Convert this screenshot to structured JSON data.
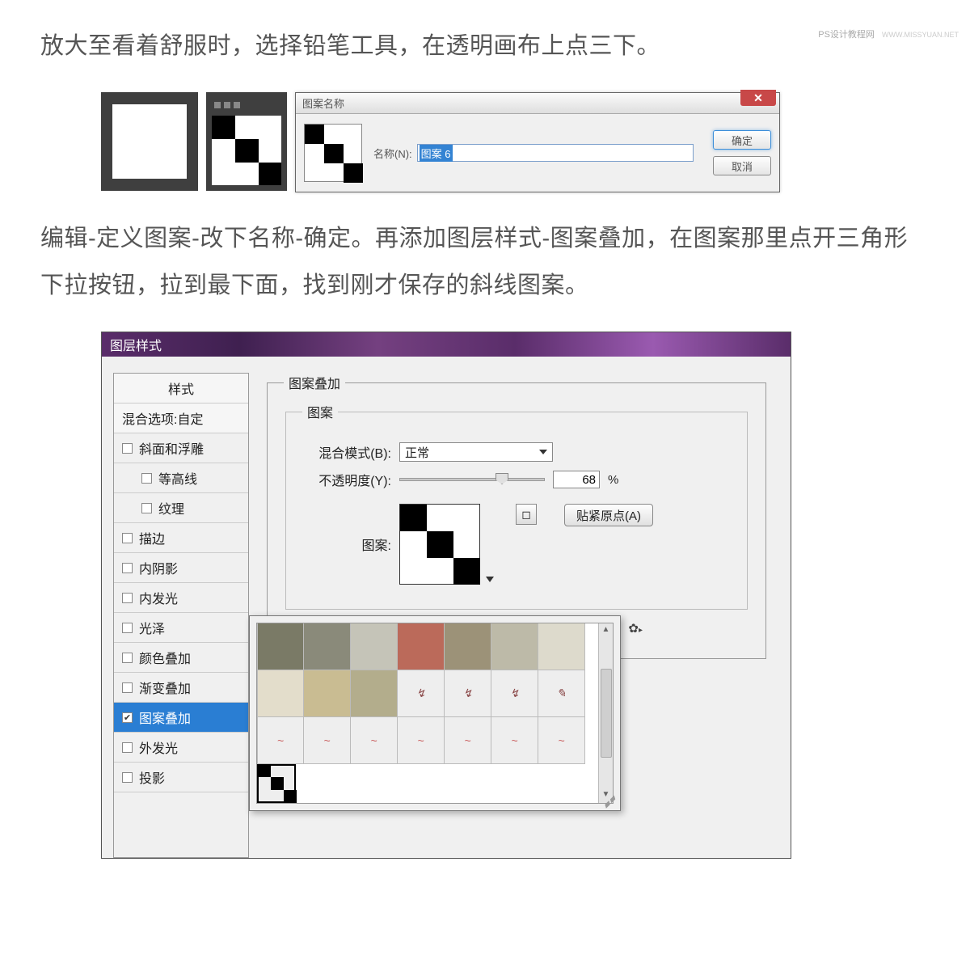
{
  "watermark": {
    "main": "PS设计教程网",
    "sub": "WWW.MISSYUAN.NET"
  },
  "paragraph1": "放大至看着舒服时，选择铅笔工具，在透明画布上点三下。",
  "paragraph2": "编辑-定义图案-改下名称-确定。再添加图层样式-图案叠加，在图案那里点开三角形下拉按钮，拉到最下面，找到刚才保存的斜线图案。",
  "dlg1": {
    "title": "图案名称",
    "name_label": "名称(N):",
    "name_value": "图案 6",
    "ok": "确定",
    "cancel": "取消"
  },
  "dlg2": {
    "title": "图层样式",
    "side": {
      "hdr": "样式",
      "blend": "混合选项:自定",
      "items": [
        "斜面和浮雕",
        "等高线",
        "纹理",
        "描边",
        "内阴影",
        "内发光",
        "光泽",
        "颜色叠加",
        "渐变叠加",
        "图案叠加",
        "外发光",
        "投影"
      ],
      "selected_index": 9,
      "checked_index": 9,
      "indent_indices": [
        1,
        2
      ]
    },
    "group_title": "图案叠加",
    "subgroup_title": "图案",
    "blendmode_label": "混合模式(B):",
    "blendmode_value": "正常",
    "opacity_label": "不透明度(Y):",
    "opacity_value": "68",
    "opacity_pct": "%",
    "pattern_label": "图案:",
    "snap_label": "贴紧原点(A)",
    "gear_label": "✿."
  }
}
